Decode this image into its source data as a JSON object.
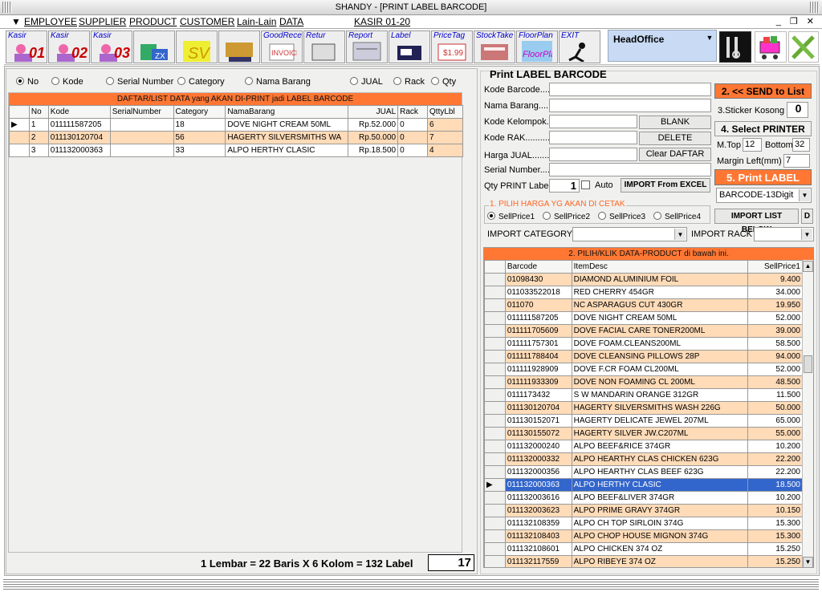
{
  "window": {
    "title": "SHANDY - [PRINT LABEL BARCODE]"
  },
  "menu": {
    "items": [
      "EMPLOYEE",
      "SUPPLIER",
      "PRODUCT",
      "CUSTOMER",
      "Lain-Lain",
      "DATA"
    ],
    "kasir": "KASIR 01-20",
    "controls": "_ ❐ ✕"
  },
  "toolbar": {
    "buttons": [
      {
        "label": "Kasir",
        "num": "01",
        "icon": "kasir-icon"
      },
      {
        "label": "Kasir",
        "num": "02",
        "icon": "kasir-icon"
      },
      {
        "label": "Kasir",
        "num": "03",
        "icon": "kasir-icon"
      },
      {
        "label": "",
        "num": "",
        "icon": "report-zx-icon"
      },
      {
        "label": "",
        "num": "",
        "icon": "sv-icon"
      },
      {
        "label": "",
        "num": "",
        "icon": "product-icon"
      },
      {
        "label": "GoodReceived",
        "num": "",
        "icon": "invoice-icon"
      },
      {
        "label": "Retur",
        "num": "",
        "icon": "retur-icon"
      },
      {
        "label": "Report",
        "num": "",
        "icon": "report-icon"
      },
      {
        "label": "Label",
        "num": "",
        "icon": "label-printer-icon"
      },
      {
        "label": "PriceTag",
        "num": "",
        "icon": "pricetag-icon"
      },
      {
        "label": "StockTake",
        "num": "",
        "icon": "stocktake-icon"
      },
      {
        "label": "FloorPlan",
        "num": "",
        "icon": "floorplan-icon"
      },
      {
        "label": "EXIT",
        "num": "",
        "icon": "exit-runner-icon"
      }
    ],
    "branch": "HeadOffice"
  },
  "left": {
    "search_options": [
      "No",
      "Kode",
      "Serial Number",
      "Category",
      "Nama Barang",
      "JUAL",
      "Rack",
      "Qty"
    ],
    "selected_option": "No",
    "list_title": "DAFTAR/LIST DATA yang AKAN DI-PRINT jadi LABEL BARCODE",
    "columns": [
      "No",
      "Kode",
      "SerialNumber",
      "Category",
      "NamaBarang",
      "JUAL",
      "Rack",
      "QttyLbl"
    ],
    "rows": [
      {
        "no": "1",
        "kode": "011111587205",
        "serial": "",
        "category": "18",
        "nama": "DOVE NIGHT CREAM 50ML",
        "jual": "Rp.52.000",
        "rack": "0",
        "qty": "6"
      },
      {
        "no": "2",
        "kode": "011130120704",
        "serial": "",
        "category": "56",
        "nama": "HAGERTY SILVERSMITHS WA",
        "jual": "Rp.50.000",
        "rack": "0",
        "qty": "7"
      },
      {
        "no": "3",
        "kode": "011132000363",
        "serial": "",
        "category": "33",
        "nama": "ALPO HERTHY CLASIC",
        "jual": "Rp.18.500",
        "rack": "0",
        "qty": "4"
      }
    ],
    "status_text": "1 Lembar = 22 Baris X 6 Kolom = 132 Label",
    "status_value": "17"
  },
  "right": {
    "title": "Print LABEL BARCODE",
    "fields": {
      "kode_barcode": "Kode Barcode......",
      "nama_barang": "Nama Barang.......",
      "kode_kelompok": "Kode Kelompok......",
      "kode_rak": "Kode RAK..........",
      "harga_jual": "Harga JUAL..........",
      "serial_number": "Serial Number.....",
      "qty_print": "Qty PRINT Label"
    },
    "qty_value": "1",
    "auto_label": "Auto",
    "buttons": {
      "blank": "BLANK",
      "delete": "DELETE",
      "clear": "Clear DAFTAR",
      "import_excel": "IMPORT From EXCEL",
      "send": "2. << SEND to List",
      "select_printer": "4. Select PRINTER",
      "print_label": "5. Print LABEL",
      "import_list": "IMPORT LIST BELOW",
      "d": "D"
    },
    "sticker_label": "3.Sticker Kosong",
    "sticker_value": "0",
    "mtop_label": "M.Top",
    "mtop_value": "12",
    "bottom_label": "Bottom",
    "bottom_value": "32",
    "margin_left_label": "Margin Left(mm)",
    "margin_left_value": "7",
    "barcode_type": "BARCODE-13Digit",
    "price_group": "1. PILIH HARGA YG AKAN DI CETAK",
    "prices": [
      "SellPrice1",
      "SellPrice2",
      "SellPrice3",
      "SellPrice4"
    ],
    "selected_price": "SellPrice1",
    "import_category_label": "IMPORT CATEGORY :",
    "import_rack_label": "IMPORT RACK :",
    "product_title": "2. PILIH/KLIK  DATA-PRODUCT di bawah ini.",
    "product_columns": [
      "Barcode",
      "ItemDesc",
      "SellPrice1"
    ],
    "products": [
      {
        "barcode": "01098430",
        "desc": "DIAMOND ALUMINIUM FOIL",
        "price": "9.400"
      },
      {
        "barcode": "011033522018",
        "desc": "RED CHERRY 454GR",
        "price": "34.000"
      },
      {
        "barcode": "011070",
        "desc": "NC ASPARAGUS CUT 430GR",
        "price": "19.950"
      },
      {
        "barcode": "011111587205",
        "desc": "DOVE NIGHT CREAM 50ML",
        "price": "52.000"
      },
      {
        "barcode": "011111705609",
        "desc": "DOVE FACIAL CARE TONER200ML",
        "price": "39.000"
      },
      {
        "barcode": "011111757301",
        "desc": "DOVE FOAM.CLEANS200ML",
        "price": "58.500"
      },
      {
        "barcode": "011111788404",
        "desc": "DOVE CLEANSING PILLOWS 28P",
        "price": "94.000"
      },
      {
        "barcode": "011111928909",
        "desc": "DOVE F.CR FOAM CL200ML",
        "price": "52.000"
      },
      {
        "barcode": "011111933309",
        "desc": "DOVE NON FOAMING CL 200ML",
        "price": "48.500"
      },
      {
        "barcode": "0111173432",
        "desc": "S W   MANDARIN ORANGE 312GR",
        "price": "11.500"
      },
      {
        "barcode": "011130120704",
        "desc": "HAGERTY SILVERSMITHS WASH 226G",
        "price": "50.000"
      },
      {
        "barcode": "011130152071",
        "desc": "HAGERTY DELICATE JEWEL 207ML",
        "price": "65.000"
      },
      {
        "barcode": "011130155072",
        "desc": "HAGERTY SILVER JW.C207ML",
        "price": "55.000"
      },
      {
        "barcode": "011132000240",
        "desc": "ALPO BEEF&RICE 374GR",
        "price": "10.200"
      },
      {
        "barcode": "011132000332",
        "desc": "ALPO HEARTHY CLAS CHICKEN 623G",
        "price": "22.200"
      },
      {
        "barcode": "011132000356",
        "desc": "ALPO HEARTHY CLAS BEEF 623G",
        "price": "22.200"
      },
      {
        "barcode": "011132000363",
        "desc": "ALPO HERTHY CLASIC",
        "price": "18.500"
      },
      {
        "barcode": "011132003616",
        "desc": "ALPO BEEF&LIVER 374GR",
        "price": "10.200"
      },
      {
        "barcode": "011132003623",
        "desc": "ALPO PRIME GRAVY 374GR",
        "price": "10.150"
      },
      {
        "barcode": "011132108359",
        "desc": "ALPO CH TOP SIRLOIN 374G",
        "price": "15.300"
      },
      {
        "barcode": "011132108403",
        "desc": "ALPO CHOP HOUSE MIGNON 374G",
        "price": "15.300"
      },
      {
        "barcode": "011132108601",
        "desc": "ALPO CHICKEN 374 OZ",
        "price": "15.250"
      },
      {
        "barcode": "011132117559",
        "desc": "ALPO RIBEYE 374 OZ",
        "price": "15.250"
      }
    ],
    "selected_product": "011132000363"
  },
  "colors": {
    "accent": "#ff7733",
    "peach": "#ffdbb8",
    "selection": "#3366cc"
  }
}
